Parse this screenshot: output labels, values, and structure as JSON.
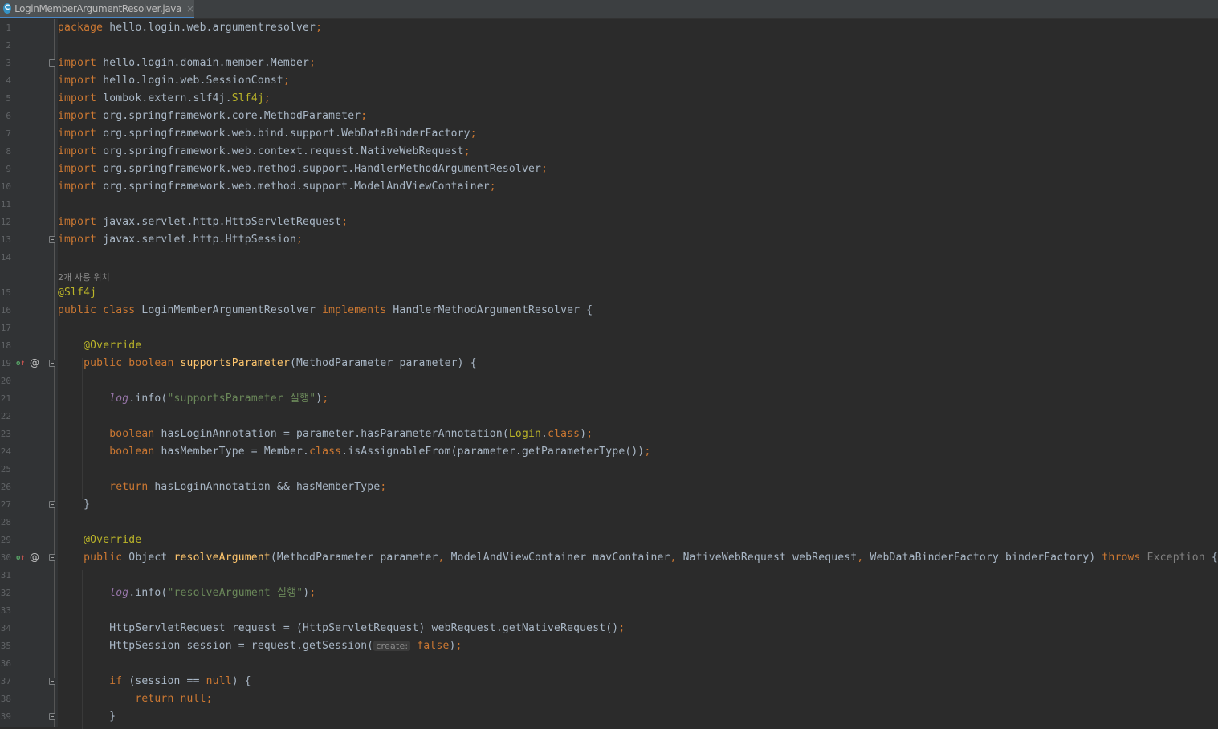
{
  "tab": {
    "title": "LoginMemberArgumentResolver.java",
    "icon_letter": "C",
    "close": "×",
    "icon": "java-class-icon"
  },
  "colors": {
    "background": "#2b2b2b",
    "keyword": "#cc7832",
    "string": "#6a8759",
    "annotation": "#bbb529",
    "method_decl": "#ffc66d",
    "static_field": "#9876aa",
    "text": "#a9b7c6"
  },
  "usage_hint": "2개 사용 위치",
  "lines": [
    {
      "n": "1",
      "t": [
        [
          "kw",
          "package "
        ],
        [
          "plain",
          "hello.login.web.argumentresolver"
        ],
        [
          "sep",
          ";"
        ]
      ]
    },
    {
      "n": "2",
      "t": []
    },
    {
      "n": "3",
      "fold": true,
      "t": [
        [
          "kw",
          "import "
        ],
        [
          "plain",
          "hello.login.domain.member.Member"
        ],
        [
          "sep",
          ";"
        ]
      ]
    },
    {
      "n": "4",
      "t": [
        [
          "kw",
          "import "
        ],
        [
          "plain",
          "hello.login.web.SessionConst"
        ],
        [
          "sep",
          ";"
        ]
      ]
    },
    {
      "n": "5",
      "t": [
        [
          "kw",
          "import "
        ],
        [
          "plain",
          "lombok.extern.slf4j."
        ],
        [
          "ann",
          "Slf4j"
        ],
        [
          "sep",
          ";"
        ]
      ]
    },
    {
      "n": "6",
      "t": [
        [
          "kw",
          "import "
        ],
        [
          "plain",
          "org.springframework.core.MethodParameter"
        ],
        [
          "sep",
          ";"
        ]
      ]
    },
    {
      "n": "7",
      "t": [
        [
          "kw",
          "import "
        ],
        [
          "plain",
          "org.springframework.web.bind.support.WebDataBinderFactory"
        ],
        [
          "sep",
          ";"
        ]
      ]
    },
    {
      "n": "8",
      "t": [
        [
          "kw",
          "import "
        ],
        [
          "plain",
          "org.springframework.web.context.request.NativeWebRequest"
        ],
        [
          "sep",
          ";"
        ]
      ]
    },
    {
      "n": "9",
      "t": [
        [
          "kw",
          "import "
        ],
        [
          "plain",
          "org.springframework.web.method.support.HandlerMethodArgumentResolver"
        ],
        [
          "sep",
          ";"
        ]
      ]
    },
    {
      "n": "10",
      "t": [
        [
          "kw",
          "import "
        ],
        [
          "plain",
          "org.springframework.web.method.support.ModelAndViewContainer"
        ],
        [
          "sep",
          ";"
        ]
      ]
    },
    {
      "n": "11",
      "t": []
    },
    {
      "n": "12",
      "t": [
        [
          "kw",
          "import "
        ],
        [
          "plain",
          "javax.servlet.http.HttpServletRequest"
        ],
        [
          "sep",
          ";"
        ]
      ]
    },
    {
      "n": "13",
      "fold": true,
      "t": [
        [
          "kw",
          "import "
        ],
        [
          "plain",
          "javax.servlet.http.HttpSession"
        ],
        [
          "sep",
          ";"
        ]
      ]
    },
    {
      "n": "14",
      "t": []
    },
    {
      "n": "",
      "hint": true,
      "t": []
    },
    {
      "n": "15",
      "t": [
        [
          "ann",
          "@Slf4j"
        ]
      ]
    },
    {
      "n": "16",
      "t": [
        [
          "kw",
          "public class "
        ],
        [
          "plain",
          "LoginMemberArgumentResolver "
        ],
        [
          "kw",
          "implements "
        ],
        [
          "plain",
          "HandlerMethodArgumentResolver {"
        ]
      ]
    },
    {
      "n": "17",
      "t": []
    },
    {
      "n": "18",
      "t": [
        [
          "plain",
          "    "
        ],
        [
          "ann",
          "@Override"
        ]
      ]
    },
    {
      "n": "19",
      "fold": true,
      "override": true,
      "t": [
        [
          "plain",
          "    "
        ],
        [
          "kw",
          "public boolean "
        ],
        [
          "fn",
          "supportsParameter"
        ],
        [
          "plain",
          "(MethodParameter parameter) {"
        ]
      ]
    },
    {
      "n": "20",
      "t": []
    },
    {
      "n": "21",
      "t": [
        [
          "plain",
          "        "
        ],
        [
          "static",
          "log"
        ],
        [
          "plain",
          ".info("
        ],
        [
          "str",
          "\"supportsParameter 실행\""
        ],
        [
          "plain",
          ")"
        ],
        [
          "sep",
          ";"
        ]
      ]
    },
    {
      "n": "22",
      "t": []
    },
    {
      "n": "23",
      "t": [
        [
          "plain",
          "        "
        ],
        [
          "kw",
          "boolean "
        ],
        [
          "plain",
          "hasLoginAnnotation = parameter.hasParameterAnnotation("
        ],
        [
          "ann",
          "Login"
        ],
        [
          "plain",
          "."
        ],
        [
          "kw",
          "class"
        ],
        [
          "plain",
          ")"
        ],
        [
          "sep",
          ";"
        ]
      ]
    },
    {
      "n": "24",
      "t": [
        [
          "plain",
          "        "
        ],
        [
          "kw",
          "boolean "
        ],
        [
          "plain",
          "hasMemberType = Member."
        ],
        [
          "kw",
          "class"
        ],
        [
          "plain",
          ".isAssignableFrom(parameter.getParameterType())"
        ],
        [
          "sep",
          ";"
        ]
      ]
    },
    {
      "n": "25",
      "t": []
    },
    {
      "n": "26",
      "t": [
        [
          "plain",
          "        "
        ],
        [
          "kw",
          "return "
        ],
        [
          "plain",
          "hasLoginAnnotation && hasMemberType"
        ],
        [
          "sep",
          ";"
        ]
      ]
    },
    {
      "n": "27",
      "fold": true,
      "t": [
        [
          "plain",
          "    }"
        ]
      ]
    },
    {
      "n": "28",
      "t": []
    },
    {
      "n": "29",
      "t": [
        [
          "plain",
          "    "
        ],
        [
          "ann",
          "@Override"
        ]
      ]
    },
    {
      "n": "30",
      "fold": true,
      "override": true,
      "t": [
        [
          "plain",
          "    "
        ],
        [
          "kw",
          "public "
        ],
        [
          "plain",
          "Object "
        ],
        [
          "fn",
          "resolveArgument"
        ],
        [
          "plain",
          "(MethodParameter parameter"
        ],
        [
          "sep",
          ", "
        ],
        [
          "plain",
          "ModelAndViewContainer mavContainer"
        ],
        [
          "sep",
          ", "
        ],
        [
          "plain",
          "NativeWebRequest webRequest"
        ],
        [
          "sep",
          ", "
        ],
        [
          "plain",
          "WebDataBinderFactory binderFactory) "
        ],
        [
          "kw",
          "throws "
        ],
        [
          "grey",
          "Exception "
        ],
        [
          "plain",
          "{"
        ]
      ]
    },
    {
      "n": "31",
      "t": []
    },
    {
      "n": "32",
      "t": [
        [
          "plain",
          "        "
        ],
        [
          "static",
          "log"
        ],
        [
          "plain",
          ".info("
        ],
        [
          "str",
          "\"resolveArgument 실행\""
        ],
        [
          "plain",
          ")"
        ],
        [
          "sep",
          ";"
        ]
      ]
    },
    {
      "n": "33",
      "t": []
    },
    {
      "n": "34",
      "t": [
        [
          "plain",
          "        HttpServletRequest request = (HttpServletRequest) webRequest.getNativeRequest()"
        ],
        [
          "sep",
          ";"
        ]
      ]
    },
    {
      "n": "35",
      "t": [
        [
          "plain",
          "        HttpSession session = request.getSession("
        ],
        [
          "inlay",
          "create:"
        ],
        [
          "plain",
          " "
        ],
        [
          "kw",
          "false"
        ],
        [
          "plain",
          ")"
        ],
        [
          "sep",
          ";"
        ]
      ]
    },
    {
      "n": "36",
      "t": []
    },
    {
      "n": "37",
      "fold": true,
      "t": [
        [
          "plain",
          "        "
        ],
        [
          "kw",
          "if "
        ],
        [
          "plain",
          "(session == "
        ],
        [
          "kw",
          "null"
        ],
        [
          "plain",
          ") {"
        ]
      ]
    },
    {
      "n": "38",
      "t": [
        [
          "plain",
          "            "
        ],
        [
          "kw",
          "return null"
        ],
        [
          "sep",
          ";"
        ]
      ]
    },
    {
      "n": "39",
      "fold": true,
      "t": [
        [
          "plain",
          "        }"
        ]
      ]
    }
  ]
}
